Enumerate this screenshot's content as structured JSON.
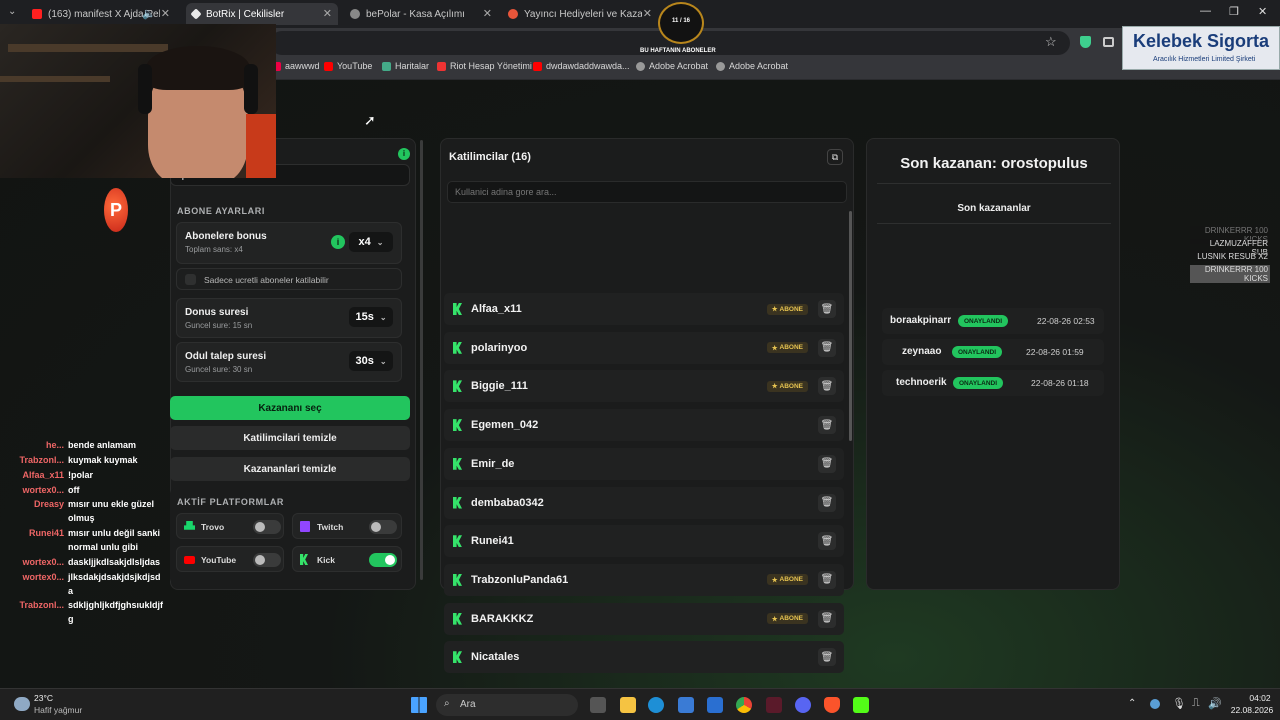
{
  "tabs": [
    {
      "title": "(163) manifest X Ajda Pekkan",
      "active": false
    },
    {
      "title": "BotRix | Cekilisler",
      "active": true
    },
    {
      "title": "bePolar - Kasa Açılımı",
      "active": false
    },
    {
      "title": "Yayıncı Hediyeleri ve Kazananlar",
      "active": false
    }
  ],
  "bookmarks": [
    "aawwwd",
    "YouTube",
    "Haritalar",
    "Riot Hesap Yönetimi",
    "dwdawdaddwawda...",
    "Adobe Acrobat",
    "Adobe Acrobat"
  ],
  "overlay": {
    "counter": "11 / 16",
    "counter_fraction": 0.69,
    "counter_caption": "BU HAFTANIN ABONELER",
    "sponsor_title": "Kelebek Sigorta",
    "sponsor_sub": "Aracılık Hizmetleri Limited Şirketi",
    "feed": [
      "DRINKERRR 100 KICKS",
      "LAZMUZAFFER SUB",
      "LUSNIK RESUB X2",
      "DRINKERRR 100 KICKS"
    ]
  },
  "left_panel": {
    "command_value": "!polar",
    "abone_title": "ABONE AYARLARI",
    "bonus_label": "Abonelere bonus",
    "bonus_sub": "Toplam sans: x4",
    "bonus_value": "x4",
    "only_paid_label": "Sadece ucretli aboneler katilabilir",
    "donus_label": "Donus suresi",
    "donus_sub": "Guncel sure: 15 sn",
    "donus_value": "15s",
    "odul_label": "Odul talep suresi",
    "odul_sub": "Guncel sure: 30 sn",
    "odul_value": "30s",
    "pick_button": "Kazananı seç",
    "clear_participants": "Katilimcilari temizle",
    "clear_winners": "Kazananlari temizle",
    "platforms_title": "AKTİF PLATFORMLAR",
    "platforms": [
      {
        "name": "Trovo",
        "on": false,
        "color": "#19d66b"
      },
      {
        "name": "Twitch",
        "on": false,
        "color": "#9146ff"
      },
      {
        "name": "YouTube",
        "on": false,
        "color": "#ff0000"
      },
      {
        "name": "Kick",
        "on": true,
        "color": "#53fc18"
      }
    ]
  },
  "participants": {
    "title": "Katilimcilar (16)",
    "search_placeholder": "Kullanici adina gore ara...",
    "badge_label": "ABONE",
    "items": [
      {
        "name": "Alfaa_x11",
        "abone": true
      },
      {
        "name": "polarinyoo",
        "abone": true
      },
      {
        "name": "Biggie_111",
        "abone": true
      },
      {
        "name": "Egemen_042",
        "abone": false
      },
      {
        "name": "Emir_de",
        "abone": false
      },
      {
        "name": "dembaba0342",
        "abone": false
      },
      {
        "name": "Runei41",
        "abone": false
      },
      {
        "name": "TrabzonluPanda61",
        "abone": true
      },
      {
        "name": "BARAKKKZ",
        "abone": true
      },
      {
        "name": "Nicatales",
        "abone": false
      }
    ]
  },
  "winners": {
    "last_winner": "Son kazanan: orostopulus",
    "list_title": "Son kazananlar",
    "status_label": "ONAYLANDI",
    "items": [
      {
        "name": "boraakpinarr",
        "date": "22-08-26 02:53"
      },
      {
        "name": "zeynaao",
        "date": "22-08-26 01:59"
      },
      {
        "name": "technoerik",
        "date": "22-08-26 01:18"
      }
    ]
  },
  "chat": [
    {
      "user": "he...",
      "msg": "bende anlamam"
    },
    {
      "user": "Trabzonl...",
      "msg": "kuymak kuymak"
    },
    {
      "user": "Alfaa_x11",
      "msg": "!polar"
    },
    {
      "user": "wortex0...",
      "msg": "off"
    },
    {
      "user": "Dreasy",
      "msg": "mısır unu ekle güzel"
    },
    {
      "user": "",
      "msg": "olmuş"
    },
    {
      "user": "Runei41",
      "msg": "mısır unlu değil sanki"
    },
    {
      "user": "",
      "msg": "normal unlu gibi"
    },
    {
      "user": "wortex0...",
      "msg": "daskljjkdlsakjdlsljdas"
    },
    {
      "user": "wortex0...",
      "msg": "jlksdakjdsakjdsjkdjsd"
    },
    {
      "user": "",
      "msg": "a"
    },
    {
      "user": "Trabzonl...",
      "msg": "sdkljghljkdfjghsıukldjf"
    },
    {
      "user": "",
      "msg": "g"
    }
  ],
  "taskbar": {
    "weather_temp": "23°C",
    "weather_desc": "Hafif yağmur",
    "search_placeholder": "Ara",
    "time": "04:02",
    "date": "22.08.2026"
  }
}
